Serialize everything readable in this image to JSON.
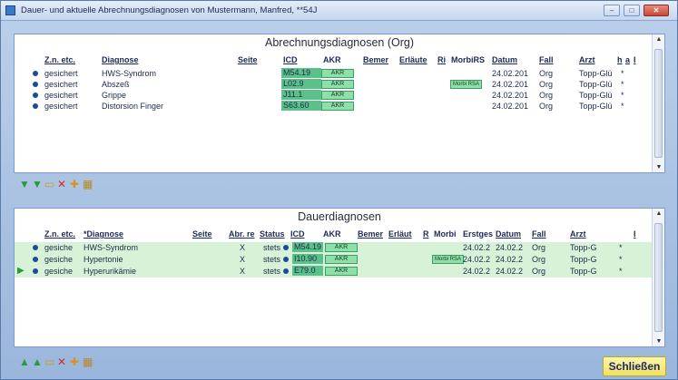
{
  "window": {
    "title": "Dauer- und aktuelle Abrechnungsdiagnosen von Mustermann, Manfred, **54J",
    "minimize": "–",
    "maximize": "□",
    "close": "✕"
  },
  "panel1": {
    "title": "Abrechnungsdiagnosen (Org)",
    "headers": {
      "ze": "Z.n. etc.",
      "diagnose": "Diagnose",
      "seite": "Seite",
      "icd": "ICD",
      "akr": "AKR",
      "bemer": "Bemer",
      "erlaeute": "Erläute",
      "ri": "Ri",
      "morbirs": "MorbiRS",
      "datum": "Datum",
      "fall": "Fall",
      "arzt": "Arzt",
      "h": "h",
      "a": "a",
      "i": "I"
    },
    "rows": [
      {
        "ze": "gesichert",
        "diagnose": "HWS-Syndrom",
        "icd": "M54.19",
        "akr": "AKR",
        "morbi": "",
        "datum": "24.02.201",
        "fall": "Org",
        "arzt": "Topp-Glü",
        "mark": "*"
      },
      {
        "ze": "gesichert",
        "diagnose": "Abszeß",
        "icd": "L02.9",
        "akr": "AKR",
        "morbi": "Morbi RSA",
        "datum": "24.02.201",
        "fall": "Org",
        "arzt": "Topp-Glü",
        "mark": "*"
      },
      {
        "ze": "gesichert",
        "diagnose": "Grippe",
        "icd": "J11.1",
        "akr": "AKR",
        "morbi": "",
        "datum": "24.02.201",
        "fall": "Org",
        "arzt": "Topp-Glü",
        "mark": "*"
      },
      {
        "ze": "gesichert",
        "diagnose": "Distorsion Finger",
        "icd": "S63.60",
        "akr": "AKR",
        "morbi": "",
        "datum": "24.02.201",
        "fall": "Org",
        "arzt": "Topp-Glü",
        "mark": "*"
      }
    ]
  },
  "panel2": {
    "title": "Dauerdiagnosen",
    "headers": {
      "ze": "Z.n. etc.",
      "diagnose": "*Diagnose",
      "seite": "Seite",
      "abr": "Abr. re",
      "status": "Status",
      "icd": "ICD",
      "akr": "AKR",
      "bemer": "Bemer",
      "erlaeut": "Erläut",
      "r": "R",
      "morbi": "Morbi",
      "erstges": "Erstges",
      "datum": "Datum",
      "fall": "Fall",
      "arzt": "Arzt",
      "i": "I"
    },
    "rows": [
      {
        "ze": "gesiche",
        "diagnose": "HWS-Syndrom",
        "abr": "X",
        "status": "stets",
        "icd": "M54.19",
        "akr": "AKR",
        "morbi": "",
        "erstges": "24.02.2",
        "datum": "24.02.2",
        "fall": "Org",
        "arzt": "Topp-G",
        "mark": "*"
      },
      {
        "ze": "gesiche",
        "diagnose": "Hypertonie",
        "abr": "X",
        "status": "stets",
        "icd": "I10.90",
        "akr": "AKR",
        "morbi": "Morbi RSA",
        "erstges": "24.02.2",
        "datum": "24.02.2",
        "fall": "Org",
        "arzt": "Topp-G",
        "mark": "*"
      },
      {
        "ze": "gesiche",
        "diagnose": "Hyperurikämie",
        "abr": "X",
        "status": "stets",
        "icd": "E79.0",
        "akr": "AKR",
        "morbi": "",
        "erstges": "24.02.2",
        "datum": "24.02.2",
        "fall": "Org",
        "arzt": "Topp-G",
        "mark": "*"
      }
    ]
  },
  "toolbar1": {
    "icons": [
      "▼",
      "▼",
      "▭",
      "✕",
      "✚",
      "▦"
    ]
  },
  "toolbar2": {
    "icons": [
      "▲",
      "▲",
      "▭",
      "✕",
      "✚",
      "▦"
    ]
  },
  "close_button": "Schließen",
  "colors": {
    "icd": "#5cc08a",
    "akr": "#8ee0a8",
    "row_green": "#d8f2d8",
    "accent_dot": "#1a4a9a",
    "close_button": "#f2e060"
  }
}
